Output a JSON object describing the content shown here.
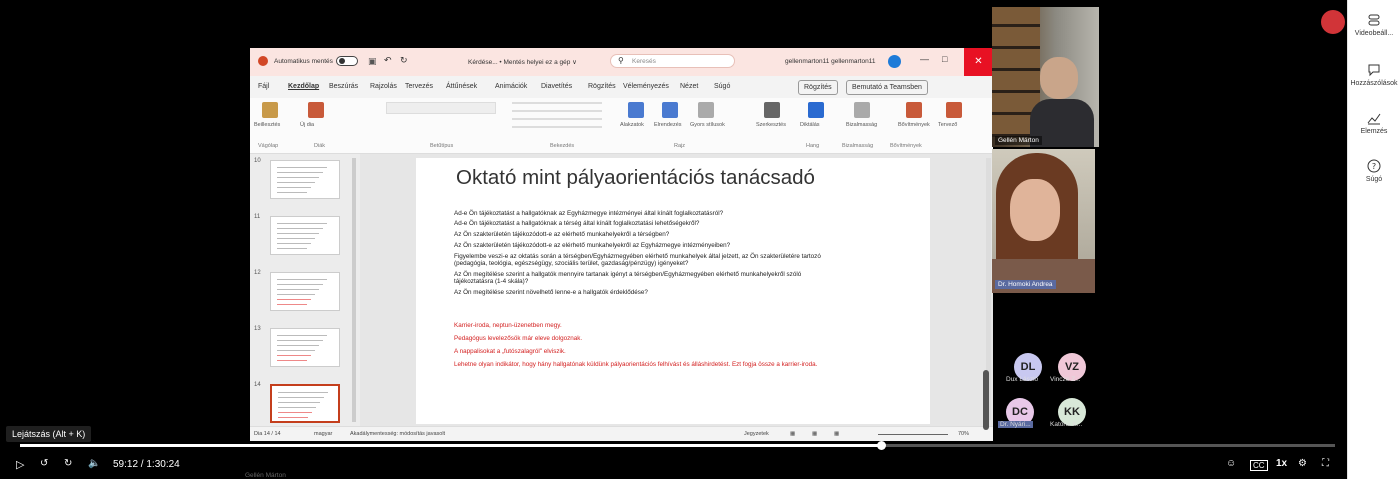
{
  "right_panel": {
    "items": [
      {
        "icon": "video-settings-icon",
        "label": "Videobeáll..."
      },
      {
        "icon": "comment-icon",
        "label": "Hozzászólások"
      },
      {
        "icon": "analytics-icon",
        "label": "Elemzés"
      },
      {
        "icon": "help-icon",
        "label": "Súgó"
      }
    ]
  },
  "ppt": {
    "titlebar": {
      "autosave": "Automatikus mentés",
      "doc": "Kérdése... • Mentés helyei ez a gép ∨",
      "search": "Keresés",
      "user": "gellenmarton11 gellenmarton11"
    },
    "menu": [
      "Fájl",
      "Kezdőlap",
      "Beszúrás",
      "Rajzolás",
      "Tervezés",
      "Áttűnések",
      "Animációk",
      "Diavetítés",
      "Rögzítés",
      "Véleményezés",
      "Nézet",
      "Súgó"
    ],
    "record_btn": "Rögzítés",
    "present_btn": "Bemutató a Teamsben",
    "ribbon": {
      "paste": "Beillesztés",
      "new_slide": "Új dia",
      "arrange": "Alakzatok",
      "order": "Elrendezés",
      "quick": "Gyors stílusok",
      "edit": "Szerkesztés",
      "dictate": "Diktálás",
      "sensitivity": "Bizalmasság",
      "addins": "Bővítmények",
      "designer": "Tervező",
      "groups": [
        "Vágólap",
        "Diák",
        "Betűtípus",
        "Bekezdés",
        "Rajz",
        "Hang",
        "Bizalmasság",
        "Bővítmények"
      ]
    },
    "thumb_numbers": [
      "10",
      "11",
      "12",
      "13",
      "14"
    ],
    "slide": {
      "title": "Oktató mint pályaorientációs tanácsadó",
      "questions": [
        "Ad-e Ön tájékoztatást a hallgatóknak az Egyházmegye intézményei által kínált foglalkoztatásról?",
        "Ad-e Ön tájékoztatást a hallgatóknak a térség által kínált foglalkoztatási lehetőségekről?",
        "Az Ön szakterületén tájékozódott-e az elérhető munkahelyekről a térségben?",
        "Az Ön szakterületén tájékozódott-e az elérhető munkahelyekről az Egyházmegye intézményeiben?",
        "Figyelembe veszi-e az oktatás során a térségben/Egyházmegyében elérhető munkahelyek által jelzett, az Ön szakterületére tartozó",
        "(pedagógia, teológia, egészségügy, szociális terület, gazdaság/pénzügy) igényeket?",
        "Az Ön megítélése szerint a hallgatók mennyire tartanak igényt a térségben/Egyházmegyében elérhető munkahelyekről szóló",
        "tájékoztatásra (1-4 skála)?",
        "Az Ön megítélése szerint növelhető lenne-e a hallgatók érdeklődése?"
      ],
      "answers": [
        "Karrier-iroda, neptun-üzenetben megy.",
        "Pedagógus levelezősök már eleve dolgoznak.",
        "A nappalisokat a „futószalagról\" elviszik.",
        "Lehetne olyan indikátor, hogy hány hallgatónak küldünk pályaorientációs felhívást és álláshirdetést. Ezt fogja össze a karrier-iroda."
      ]
    },
    "status": {
      "slide_no": "Dia 14 / 14",
      "lang": "magyar",
      "access": "Akadálymentesség: módosítás javasolt",
      "notes": "Jegyzetek",
      "zoom": "70%"
    }
  },
  "participants": {
    "cam1_name": "Gellén Márton",
    "cam2_name": "Dr. Homoki Andrea",
    "avatars": [
      {
        "initials": "DL",
        "name": "Dux László",
        "color": "#c8c8f0"
      },
      {
        "initials": "VZ",
        "name": "Vincze Z...",
        "color": "#f0c8d8"
      },
      {
        "initials": "DC",
        "name": "Dr. Nyári...",
        "color": "#e8c8e8"
      },
      {
        "initials": "KK",
        "name": "Katona K...",
        "color": "#d8e8d8"
      }
    ]
  },
  "player": {
    "tooltip": "Lejátszás (Alt + K)",
    "time": "59:12 / 1:30:24",
    "progress": 0.655,
    "speed": "1x",
    "ghost_name": "Gellén Márton"
  }
}
